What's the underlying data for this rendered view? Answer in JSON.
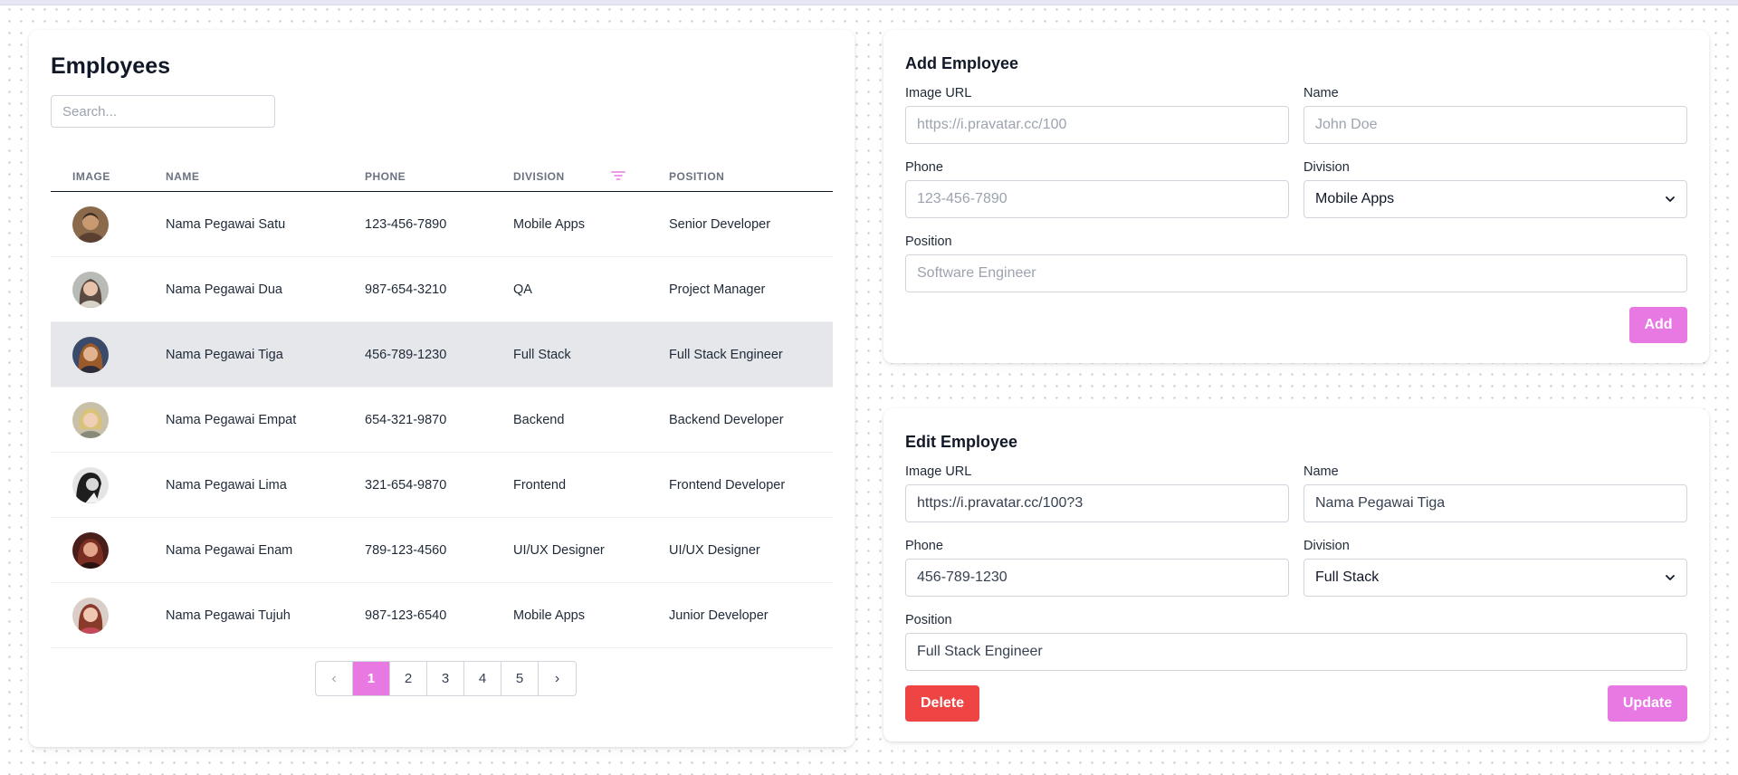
{
  "list": {
    "title": "Employees",
    "search_placeholder": "Search...",
    "columns": [
      "IMAGE",
      "NAME",
      "PHONE",
      "DIVISION",
      "POSITION"
    ],
    "filter_icon": "filter-icon",
    "rows": [
      {
        "name": "Nama Pegawai Satu",
        "phone": "123-456-7890",
        "division": "Mobile Apps",
        "position": "Senior Developer",
        "selected": false
      },
      {
        "name": "Nama Pegawai Dua",
        "phone": "987-654-3210",
        "division": "QA",
        "position": "Project Manager",
        "selected": false
      },
      {
        "name": "Nama Pegawai Tiga",
        "phone": "456-789-1230",
        "division": "Full Stack",
        "position": "Full Stack Engineer",
        "selected": true
      },
      {
        "name": "Nama Pegawai Empat",
        "phone": "654-321-9870",
        "division": "Backend",
        "position": "Backend Developer",
        "selected": false
      },
      {
        "name": "Nama Pegawai Lima",
        "phone": "321-654-9870",
        "division": "Frontend",
        "position": "Frontend Developer",
        "selected": false
      },
      {
        "name": "Nama Pegawai Enam",
        "phone": "789-123-4560",
        "division": "UI/UX Designer",
        "position": "UI/UX Designer",
        "selected": false
      },
      {
        "name": "Nama Pegawai Tujuh",
        "phone": "987-123-6540",
        "division": "Mobile Apps",
        "position": "Junior Developer",
        "selected": false
      }
    ],
    "pagination": {
      "prev_icon": "chevron-left-icon",
      "next_icon": "chevron-right-icon",
      "pages": [
        "1",
        "2",
        "3",
        "4",
        "5"
      ],
      "current": "1"
    }
  },
  "add_form": {
    "title": "Add Employee",
    "image_label": "Image URL",
    "image_placeholder": "https://i.pravatar.cc/100",
    "name_label": "Name",
    "name_placeholder": "John Doe",
    "phone_label": "Phone",
    "phone_placeholder": "123-456-7890",
    "division_label": "Division",
    "division_value": "Mobile Apps",
    "position_label": "Position",
    "position_placeholder": "Software Engineer",
    "add_button": "Add"
  },
  "edit_form": {
    "title": "Edit Employee",
    "image_label": "Image URL",
    "image_value": "https://i.pravatar.cc/100?3",
    "name_label": "Name",
    "name_value": "Nama Pegawai Tiga",
    "phone_label": "Phone",
    "phone_value": "456-789-1230",
    "division_label": "Division",
    "division_value": "Full Stack",
    "position_label": "Position",
    "position_value": "Full Stack Engineer",
    "delete_button": "Delete",
    "update_button": "Update"
  },
  "colors": {
    "accent": "#e879e2",
    "danger": "#ef4444",
    "selected_row": "#e5e7eb"
  }
}
